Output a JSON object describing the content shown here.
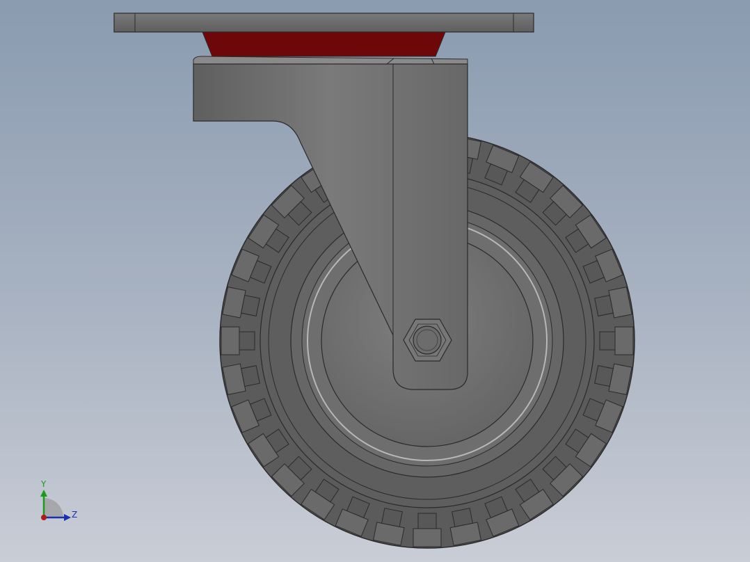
{
  "viewport": {
    "background_top": "#8a9bb0",
    "background_bottom": "#c9cdd6"
  },
  "model": {
    "top_plate_color": "#707070",
    "swivel_bearing_color": "#7a0a0a",
    "fork_color": "#6f6f6f",
    "tire_color": "#5e5e5e",
    "hub_color": "#777777",
    "tread_block_count": 32
  },
  "triad": {
    "y_label": "Y",
    "z_label": "Z",
    "y_color": "#1a9a1a",
    "z_color": "#1a2fb0",
    "x_color": "#b01a1a"
  }
}
